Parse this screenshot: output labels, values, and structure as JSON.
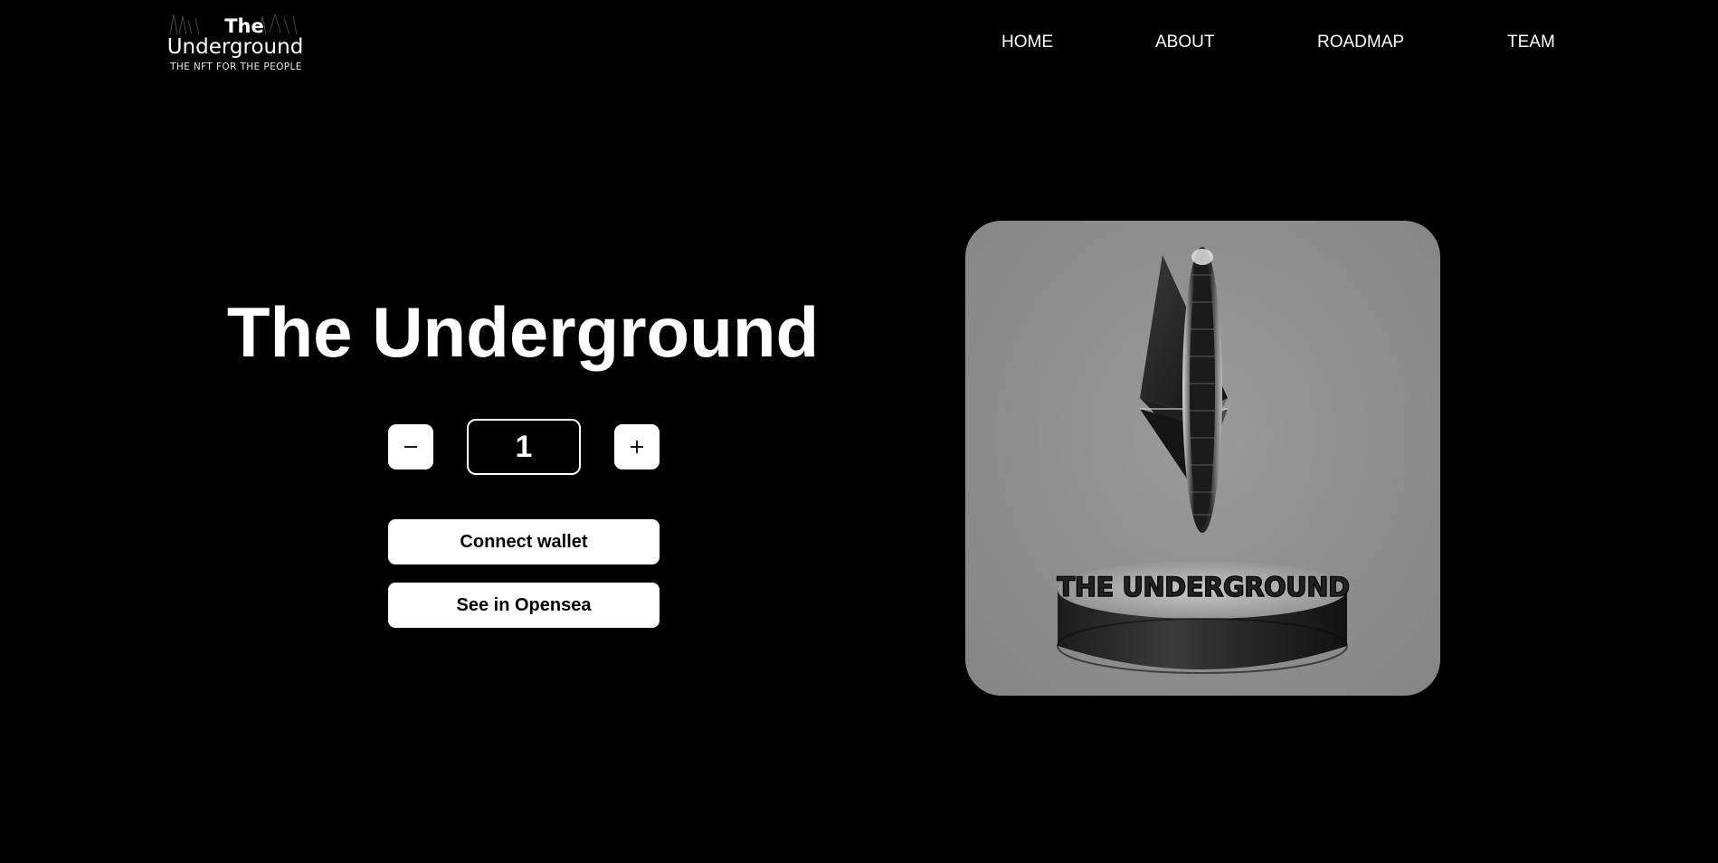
{
  "header": {
    "logo": {
      "line1": "The",
      "line2": "Underground",
      "tagline": "THE NFT FOR THE PEOPLE"
    },
    "nav": [
      {
        "label": "HOME"
      },
      {
        "label": "ABOUT"
      },
      {
        "label": "ROADMAP"
      },
      {
        "label": "TEAM"
      }
    ]
  },
  "hero": {
    "title": "The Underground",
    "mint": {
      "decrement_icon": "minus-icon",
      "increment_icon": "plus-icon",
      "quantity": "1"
    },
    "connect_label": "Connect wallet",
    "opensea_label": "See in Opensea"
  },
  "artwork": {
    "plinth_text": "THE UNDERGROUND",
    "background_color": "#8e8e8e"
  },
  "colors": {
    "page_background": "#000000",
    "button_background": "#ffffff",
    "text": "#ffffff"
  }
}
